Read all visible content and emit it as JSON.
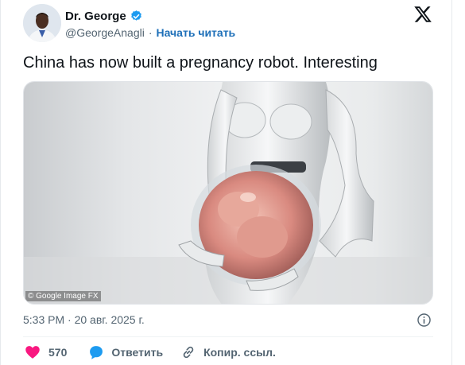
{
  "author": {
    "display_name": "Dr. George",
    "handle": "@GeorgeAnagli",
    "separator": "·",
    "follow_label": "Начать читать"
  },
  "tweet": {
    "text": "China has now built a pregnancy robot. Interesting",
    "image_watermark": "© Google Image FX",
    "timestamp": "5:33 PM · 20 авг. 2025 г."
  },
  "actions": {
    "like_count": "570",
    "reply_label": "Ответить",
    "copy_label": "Копир. ссыл."
  },
  "colors": {
    "like": "#f91880",
    "reply": "#1d9bf0",
    "verified": "#1d9bf0",
    "link": "#1d6fb8"
  }
}
